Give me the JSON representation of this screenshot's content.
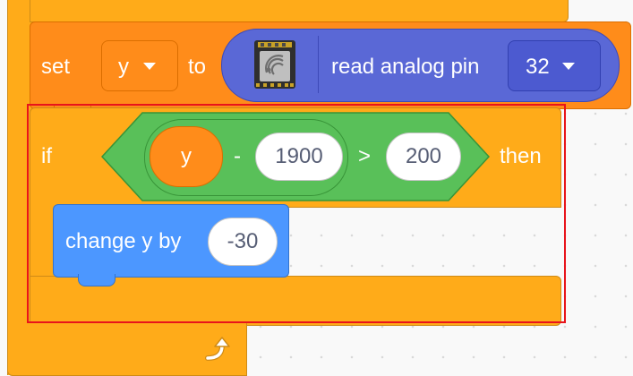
{
  "set_block": {
    "set_label": "set",
    "variable": "y",
    "to_label": "to",
    "reporter": {
      "icon": "esp32-chip-icon",
      "label": "read analog pin",
      "pin_value": "32"
    }
  },
  "if_block": {
    "if_label": "if",
    "condition": {
      "variable": "y",
      "minus_operator": "-",
      "subtrahend": "1900",
      "comparison_operator": ">",
      "threshold": "200"
    },
    "then_label": "then",
    "body": {
      "change_label": "change y by",
      "change_value": "-30"
    }
  },
  "loop": {
    "arrow_icon": "loop-arrow-icon"
  },
  "colors": {
    "control": "#ffab19",
    "variables": "#ff8c1a",
    "operators": "#59c059",
    "extension": "#5a68d6",
    "motion": "#4c97ff",
    "highlight": "#e8141b"
  }
}
